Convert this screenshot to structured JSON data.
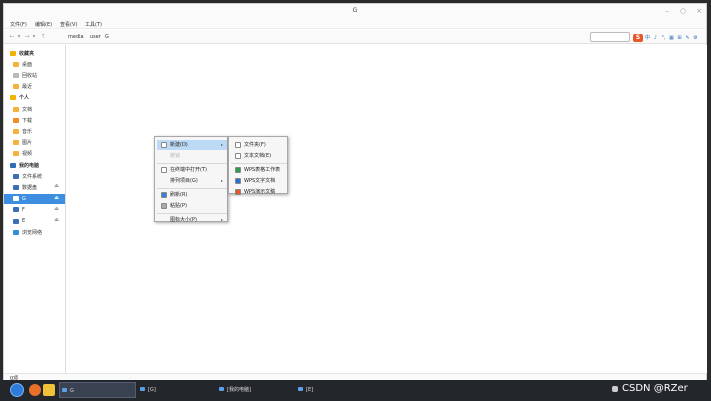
{
  "window": {
    "title": "G",
    "controls": [
      "–",
      "○",
      "×"
    ]
  },
  "menubar": [
    "文件(F)",
    "编辑(E)",
    "查看(V)",
    "工具(T)"
  ],
  "toolbar": {
    "nav": [
      "←",
      "▾",
      "→",
      "▾",
      "↑"
    ],
    "breadcrumb": [
      "media",
      "user",
      "G"
    ],
    "ime": {
      "logo": "S",
      "cells": [
        "中",
        "♪",
        "°,",
        "▦",
        "⊞",
        "✎",
        "⚙"
      ]
    }
  },
  "sidebar": [
    {
      "label": "收藏夹",
      "type": "header",
      "icon": "star-icon",
      "color": "#f0b400"
    },
    {
      "label": "桌面",
      "icon": "desktop-icon",
      "color": "#f3b23a"
    },
    {
      "label": "回收站",
      "icon": "trash-icon",
      "color": "#b9b9b9"
    },
    {
      "label": "最近",
      "icon": "recent-icon",
      "color": "#f3b23a"
    },
    {
      "label": "个人",
      "type": "header",
      "icon": "person-icon",
      "color": "#f0b400"
    },
    {
      "label": "文档",
      "icon": "document-icon",
      "color": "#f3b23a"
    },
    {
      "label": "下载",
      "icon": "download-icon",
      "color": "#f08a24"
    },
    {
      "label": "音乐",
      "icon": "music-icon",
      "color": "#f3b23a"
    },
    {
      "label": "图片",
      "icon": "picture-icon",
      "color": "#f3b23a"
    },
    {
      "label": "视频",
      "icon": "video-icon",
      "color": "#f3b23a"
    },
    {
      "label": "我的电脑",
      "type": "header",
      "icon": "computer-icon",
      "color": "#2f6db5"
    },
    {
      "label": "文件系统",
      "icon": "drive-icon",
      "color": "#3b6fb6"
    },
    {
      "label": "数据盘",
      "icon": "drive-icon",
      "color": "#3b6fb6",
      "eject": "⏏"
    },
    {
      "label": "G",
      "icon": "drive-icon",
      "color": "#ffffff",
      "selected": true,
      "eject": "⏏"
    },
    {
      "label": "F",
      "icon": "drive-icon",
      "color": "#3b6fb6",
      "eject": "⏏"
    },
    {
      "label": "E",
      "icon": "drive-icon",
      "color": "#3b6fb6",
      "eject": "⏏"
    },
    {
      "label": "浏览网络",
      "icon": "network-icon",
      "color": "#2f8fd8"
    }
  ],
  "context_menu": {
    "items": [
      {
        "label": "新建(D)",
        "icon": "new-icon",
        "color": "#ffffff",
        "submenu": true,
        "highlight": true
      },
      {
        "label": "撤销",
        "disabled": true
      },
      {
        "separator": true
      },
      {
        "label": "在终端中打开(T)",
        "icon": "terminal-icon",
        "color": "#ffffff"
      },
      {
        "label": "排列项目(G)",
        "submenu": true
      },
      {
        "separator": true
      },
      {
        "label": "刷新(R)",
        "icon": "refresh-icon",
        "color": "#3a7fd5"
      },
      {
        "label": "粘贴(P)",
        "icon": "paste-icon",
        "color": "#aaaaaa"
      },
      {
        "separator": true
      },
      {
        "label": "图标大小(P)",
        "submenu": true
      }
    ],
    "submenu": [
      {
        "label": "文件夹(F)",
        "icon": "folder-icon",
        "color": "#ffffff"
      },
      {
        "label": "文本文档(E)",
        "icon": "text-file-icon",
        "color": "#ffffff"
      },
      {
        "separator": true
      },
      {
        "label": "WPS表格工作表",
        "icon": "wps-sheet-icon",
        "color": "#2e9b4f"
      },
      {
        "label": "WPS文字文档",
        "icon": "wps-writer-icon",
        "color": "#2f6fd0"
      },
      {
        "label": "WPS演示文稿",
        "icon": "wps-slides-icon",
        "color": "#e4572e"
      }
    ]
  },
  "statusbar": {
    "text": "0项"
  },
  "taskbar": {
    "tasks": [
      {
        "label": "G",
        "active": true
      },
      {
        "label": "[G]",
        "active": false
      },
      {
        "label": "[我的电脑]",
        "active": false
      },
      {
        "label": "[E]",
        "active": false
      }
    ],
    "tray_text": "CSDN @RZer"
  },
  "colors": {
    "accent": "#3d8ee0",
    "taskbar": "#23262b"
  }
}
